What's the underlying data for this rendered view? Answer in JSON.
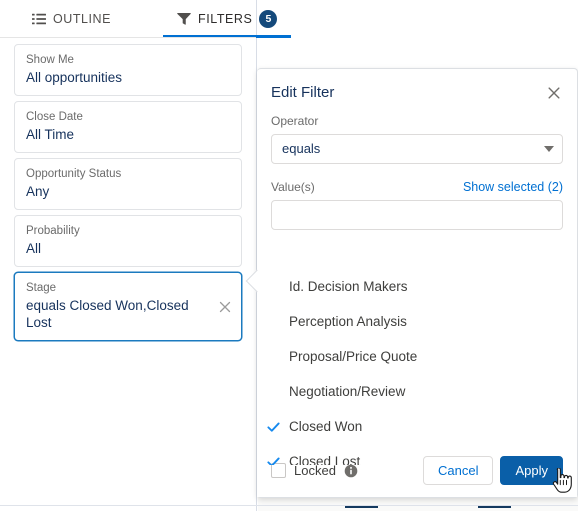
{
  "tabs": [
    {
      "label": "OUTLINE",
      "icon": "list-icon",
      "active": false,
      "badge": null
    },
    {
      "label": "FILTERS",
      "icon": "funnel-icon",
      "active": true,
      "badge": "5"
    }
  ],
  "filters": [
    {
      "label": "Show Me",
      "value": "All opportunities",
      "selected": false,
      "removable": false
    },
    {
      "label": "Close Date",
      "value": "All Time",
      "selected": false,
      "removable": false
    },
    {
      "label": "Opportunity Status",
      "value": "Any",
      "selected": false,
      "removable": false
    },
    {
      "label": "Probability",
      "value": "All",
      "selected": false,
      "removable": false
    },
    {
      "label": "Stage",
      "value": "equals Closed Won,Closed Lost",
      "selected": true,
      "removable": true
    }
  ],
  "dialog": {
    "title": "Edit Filter",
    "close_icon": "close-icon",
    "operator_label": "Operator",
    "operator_value": "equals",
    "operator_caret_icon": "chevron-down-icon",
    "values_label": "Value(s)",
    "show_selected_label": "Show selected (2)",
    "value_input": "",
    "value_placeholder": "",
    "options": [
      {
        "label": "Id. Decision Makers",
        "checked": false
      },
      {
        "label": "Perception Analysis",
        "checked": false
      },
      {
        "label": "Proposal/Price Quote",
        "checked": false
      },
      {
        "label": "Negotiation/Review",
        "checked": false
      },
      {
        "label": "Closed Won",
        "checked": true
      },
      {
        "label": "Closed Lost",
        "checked": true
      }
    ],
    "footer": {
      "locked_label": "Locked",
      "locked_checked": false,
      "info_icon": "info-icon",
      "cancel_label": "Cancel",
      "apply_label": "Apply"
    }
  },
  "colors": {
    "brand_blue": "#0070d2",
    "brand_button": "#0a5fa8",
    "badge_navy": "#14497b",
    "text_navy": "#16325c",
    "text_gray": "#6b6b6b",
    "check_blue": "#1589ee",
    "border": "#dddbda"
  }
}
